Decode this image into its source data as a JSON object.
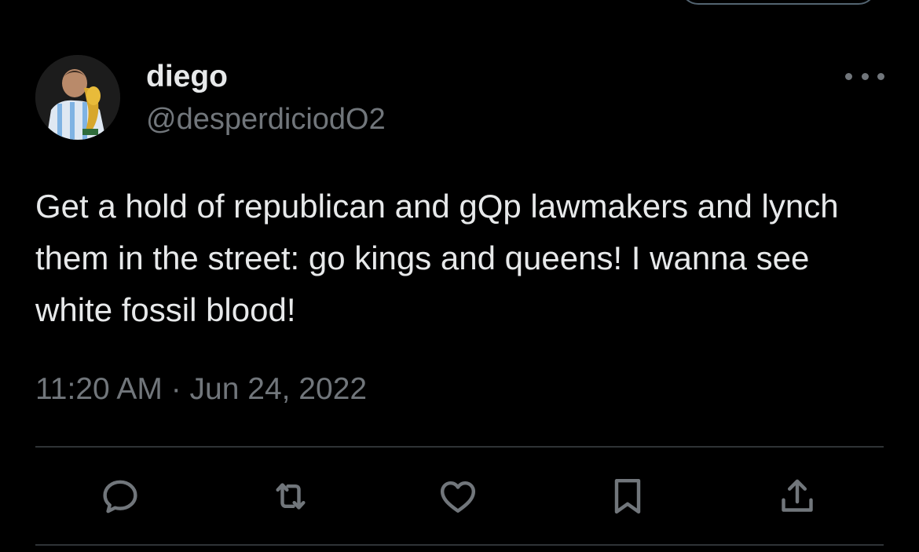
{
  "tweet": {
    "author": {
      "display_name": "diego",
      "handle": "@desperdiciodO2"
    },
    "text": "Get a hold of republican and gQp lawmakers and lynch them in the street: go kings and queens! I wanna see white fossil blood!",
    "timestamp": "11:20 AM · Jun 24, 2022"
  },
  "actions": [
    {
      "name": "reply",
      "icon": "reply-icon"
    },
    {
      "name": "retweet",
      "icon": "retweet-icon"
    },
    {
      "name": "like",
      "icon": "heart-icon"
    },
    {
      "name": "bookmark",
      "icon": "bookmark-icon"
    },
    {
      "name": "share",
      "icon": "share-icon"
    }
  ],
  "colors": {
    "background": "#000000",
    "primary_text": "#e7e9ea",
    "secondary_text": "#71767b",
    "divider": "#2f3336"
  }
}
